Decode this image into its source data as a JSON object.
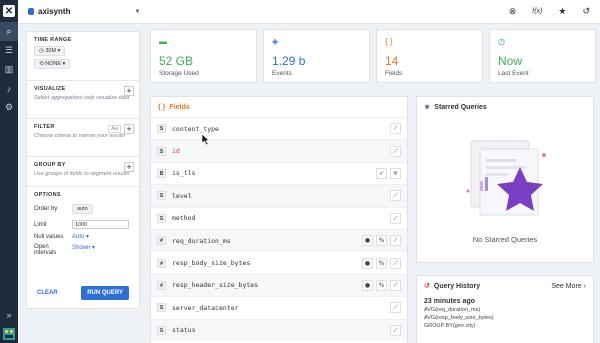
{
  "app": {
    "datasource": "axisynth"
  },
  "colors": {
    "green": "#3eaf5c",
    "blue": "#2e6fd6",
    "purple": "#6b48c8",
    "orange": "#e07a1f",
    "teal": "#1ea7c5",
    "red": "#d63b3b"
  },
  "rail": {
    "icons": [
      "search-icon",
      "list-icon",
      "book-icon",
      "bell-icon",
      "gear-icon"
    ]
  },
  "sidebar": {
    "time_range": {
      "title": "TIME RANGE",
      "value": "30M",
      "compare": "NONE"
    },
    "visualize": {
      "title": "VISUALIZE",
      "hint": "Select aggregations help visualize data"
    },
    "filter": {
      "title": "FILTER",
      "hint": "Choose criteria to narrow your results",
      "case_toggle": "Aa"
    },
    "group_by": {
      "title": "GROUP BY",
      "hint": "Use groups of fields to segment results"
    },
    "options": {
      "title": "OPTIONS",
      "order_by_label": "Order by",
      "order_by_value": "auto",
      "limit_label": "Limit",
      "limit_value": "1000",
      "null_values_label": "Null values",
      "null_values_value": "Auto",
      "open_intervals_label_1": "Open",
      "open_intervals_label_2": "intervals",
      "open_intervals_value": "Shown"
    },
    "clear_label": "CLEAR",
    "run_label": "RUN QUERY"
  },
  "stats": [
    {
      "value": "52 GB",
      "label": "Storage Used",
      "icon": "database-icon",
      "color": "#3eaf5c"
    },
    {
      "value": "1.29 b",
      "label": "Events",
      "icon": "layers-icon",
      "color": "#2e6fd6"
    },
    {
      "value": "14",
      "label": "Fields",
      "icon": "braces-icon",
      "color": "#e07a1f"
    },
    {
      "value": "Now",
      "label": "Last Event",
      "icon": "clock-icon",
      "color": "#3eaf5c"
    }
  ],
  "fields": {
    "title": "Fields",
    "rows": [
      {
        "name": "content_type",
        "type": "S"
      },
      {
        "name": "id",
        "type": "S"
      },
      {
        "name": "is_tls",
        "type": "B"
      },
      {
        "name": "level",
        "type": "S"
      },
      {
        "name": "method",
        "type": "S"
      },
      {
        "name": "req_duration_ms",
        "type": "#"
      },
      {
        "name": "resp_body_size_bytes",
        "type": "#"
      },
      {
        "name": "resp_header_size_bytes",
        "type": "#"
      },
      {
        "name": "server_datacenter",
        "type": "S"
      },
      {
        "name": "status",
        "type": "S"
      }
    ]
  },
  "starred": {
    "title": "Starred Queries",
    "empty": "No Starred Queries"
  },
  "history": {
    "title": "Query History",
    "see_more": "See More",
    "items": [
      {
        "time": "23 minutes ago",
        "q1": "AVG(req_duration_ms)",
        "q2": "AVG(resp_body_size_bytes)",
        "q3": "GROUP BY(geo.city)"
      }
    ]
  }
}
